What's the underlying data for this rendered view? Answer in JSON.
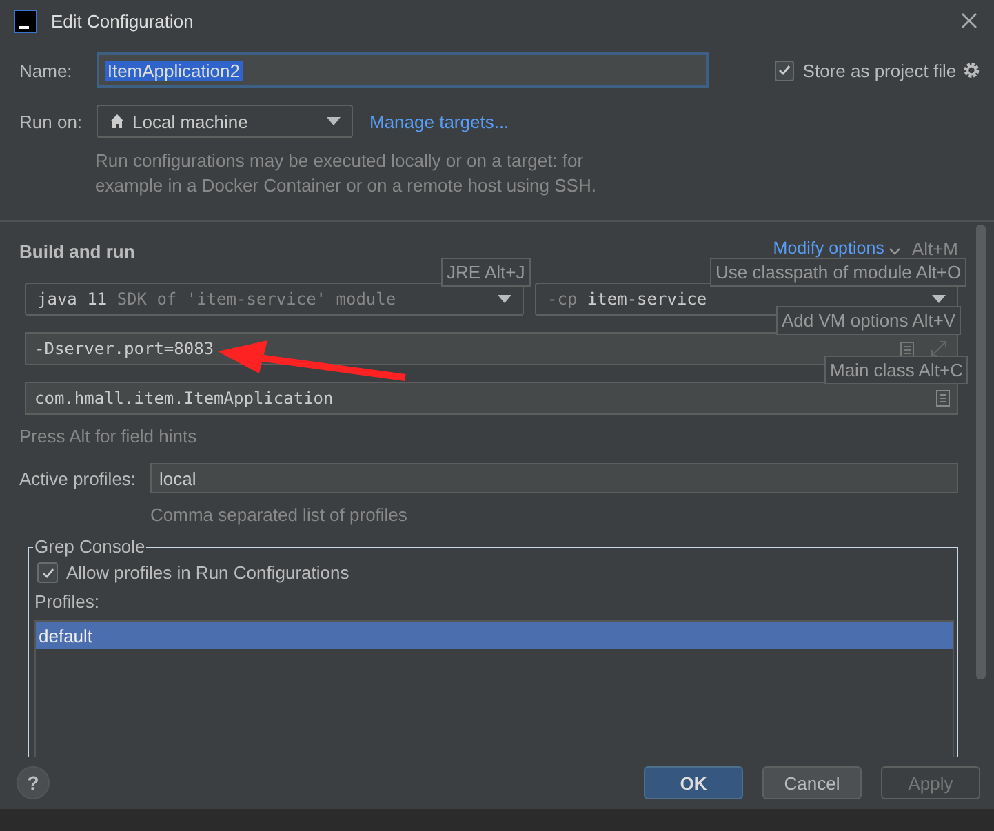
{
  "window": {
    "title": "Edit Configuration"
  },
  "name_field": {
    "label": "Name:",
    "value": "ItemApplication2"
  },
  "store_as_project_file": {
    "label": "Store as project file",
    "checked": true
  },
  "run_on": {
    "label": "Run on:",
    "value": "Local machine",
    "link": "Manage targets...",
    "description": "Run configurations may be executed locally or on a target: for example in a Docker Container or on a remote host using SSH."
  },
  "build_and_run": {
    "title": "Build and run",
    "modify_options": "Modify options",
    "modify_shortcut": "Alt+M",
    "jre": {
      "version": "java 11",
      "detail": "SDK of 'item-service' module"
    },
    "classpath": {
      "flag": "-cp",
      "module": "item-service"
    },
    "vm_options": "-Dserver.port=8083",
    "main_class": "com.hmall.item.ItemApplication",
    "hint": "Press Alt for field hints",
    "tooltips": [
      {
        "kind": "jre",
        "text": "JRE Alt+J"
      },
      {
        "kind": "classpath",
        "text": "Use classpath of module Alt+O"
      },
      {
        "kind": "vm",
        "text": "Add VM options Alt+V"
      },
      {
        "kind": "main",
        "text": "Main class Alt+C"
      }
    ]
  },
  "active_profiles": {
    "label": "Active profiles:",
    "value": "local",
    "hint": "Comma separated list of profiles"
  },
  "grep_console": {
    "title": "Grep Console",
    "allow_profiles": {
      "label": "Allow profiles in Run Configurations",
      "checked": true
    },
    "profiles_label": "Profiles:",
    "profiles": [
      {
        "name": "default",
        "selected": true
      }
    ]
  },
  "buttons": [
    {
      "label": "OK",
      "kind": "default",
      "disabled": false
    },
    {
      "label": "Cancel",
      "kind": "normal",
      "disabled": false
    },
    {
      "label": "Apply",
      "kind": "normal",
      "disabled": true
    }
  ],
  "help": "?"
}
